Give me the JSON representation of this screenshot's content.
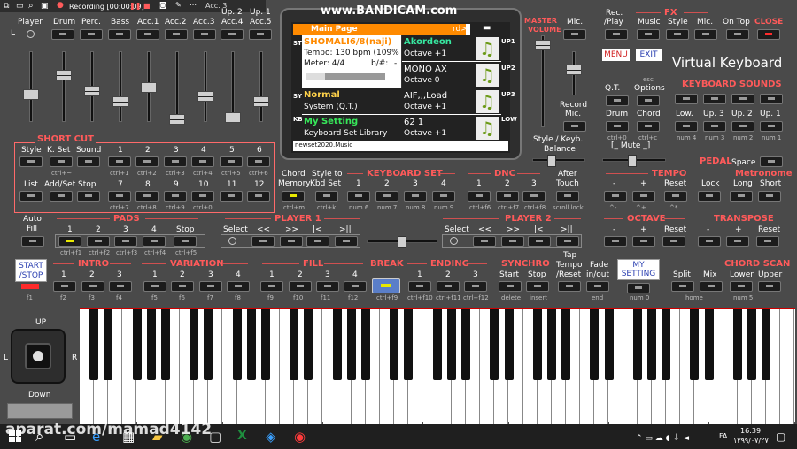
{
  "recorder": {
    "label": "Recording [00:00:09]"
  },
  "watermark": {
    "text": "www.BANDICAM.com",
    "bottom": "aparat.com/mamad4142"
  },
  "title": "Virtual Keyboard",
  "menu_label": "MENU",
  "exit_label": "EXIT",
  "top_mixer": {
    "cols": [
      "Player",
      "Drum",
      "Perc.",
      "Bass",
      "Acc.1",
      "Acc.2",
      "Acc.3",
      "Acc.4",
      "Acc.5"
    ],
    "up_labels": [
      "Up. 2",
      "Up. 1"
    ],
    "l_label": "L"
  },
  "master": {
    "label1": "MASTER",
    "label2": "VOLUME"
  },
  "mic_label": "Mic.",
  "fx": {
    "title": "FX",
    "rec_play": "Rec.\n/Play",
    "rec": "Rec.",
    "play": "/Play",
    "music": "Music",
    "style": "Style",
    "mic": "Mic.",
    "on_top": "On Top",
    "close": "CLOSE"
  },
  "record_mic": {
    "l1": "Record",
    "l2": "Mic."
  },
  "main_page": {
    "header": "Main Page",
    "rd": "rd>",
    "style_tab": "STYLE",
    "style_name": "SHOMALI6/8(naji)",
    "tempo": "Tempo: 130 bpm (109%",
    "meter": "Meter: 4/4",
    "bsharp": "b/#:",
    "minus": "-",
    "upper1": "Akordeon",
    "upper1_oct": "Octave +1",
    "upper2": "MONO AX",
    "upper2_oct": "Octave 0",
    "sys_tab": "SYS",
    "system_name": "Normal",
    "system_sub": "System (Q.T.)",
    "upper3": "AIF,,,Load",
    "upper3_oct": "Octave +1",
    "kbd_tab": "KBD",
    "my_setting": "My Setting",
    "kbd_lib": "Keyboard Set Library",
    "lower": "62 1",
    "lower_oct": "Octave +1",
    "right_tabs": [
      "UP1",
      "UP2",
      "UP3",
      "LOW"
    ],
    "footer": "newset2020.Music"
  },
  "style_keyb": {
    "l1": "Style / Keyb.",
    "l2": "Balance"
  },
  "qt": {
    "l": "Q.T.",
    "esc": "esc",
    "options": "Options"
  },
  "keyboard_sounds": {
    "title": "KEYBOARD SOUNDS",
    "cols": [
      "Low.",
      "Up. 3",
      "Up. 2",
      "Up. 1"
    ],
    "hints": [
      "num 4",
      "num 3",
      "num 2",
      "num 1"
    ]
  },
  "drum_chord": {
    "drum": "Drum",
    "chord": "Chord",
    "drum_hint": "ctrl+0",
    "chord_hint": "ctrl+c",
    "mute": "[_ Mute _]"
  },
  "pedal": {
    "label": "PEDAL",
    "space": "Space"
  },
  "short_cut": {
    "title": "SHORT CUT",
    "row1": [
      "Style",
      "K. Set",
      "Sound",
      "1",
      "2",
      "3",
      "4",
      "5",
      "6"
    ],
    "row1_hints": [
      "ctrl+~",
      "",
      "ctrl+1",
      "ctrl+2",
      "ctrl+3",
      "ctrl+4",
      "ctrl+5",
      "ctrl+6"
    ],
    "row2": [
      "List",
      "Add/Set",
      "Stop",
      "7",
      "8",
      "9",
      "10",
      "11",
      "12"
    ],
    "row2_hints": [
      "ctrl+7",
      "ctrl+8",
      "ctrl+9",
      "ctrl+0"
    ]
  },
  "chord_memory": {
    "l1": "Chord",
    "l2": "Memory",
    "hint": "ctrl+m"
  },
  "style_to": {
    "l1": "Style to",
    "l2": "Kbd Set",
    "hint": "ctrl+k"
  },
  "keyboard_set": {
    "title": "KEYBOARD SET",
    "cols": [
      "1",
      "2",
      "3",
      "4"
    ],
    "hints": [
      "num 6",
      "num 7",
      "num 8",
      "num 9"
    ]
  },
  "dnc": {
    "title": "DNC",
    "cols": [
      "1",
      "2",
      "3"
    ],
    "hints": [
      "ctrl+f6",
      "ctrl+f7",
      "ctrl+f8"
    ]
  },
  "after_touch": {
    "l1": "After",
    "l2": "Touch",
    "hint": "scroll lock"
  },
  "tempo": {
    "title": "TEMPO",
    "cols": [
      "-",
      "+",
      "Reset",
      "Lock"
    ],
    "hints": [
      "^-",
      "^+",
      "^*"
    ]
  },
  "metronome": {
    "title": "Metronome",
    "cols": [
      "Long",
      "Short"
    ]
  },
  "auto_fill": {
    "l1": "Auto",
    "l2": "Fill"
  },
  "pads": {
    "title": "PADS",
    "cols": [
      "1",
      "2",
      "3",
      "4",
      "Stop"
    ],
    "hints": [
      "ctrl+f1",
      "ctrl+f2",
      "ctrl+f3",
      "ctrl+f4",
      "ctrl+f5"
    ]
  },
  "player1": {
    "title": "PLAYER 1",
    "cols": [
      "Select",
      "<<",
      ">>",
      "|<",
      ">||"
    ]
  },
  "player2": {
    "title": "PLAYER 2",
    "cols": [
      "Select",
      "<<",
      ">>",
      "|<",
      ">||"
    ]
  },
  "octave": {
    "title": "OCTAVE",
    "cols": [
      "-",
      "+",
      "Reset"
    ]
  },
  "transpose": {
    "title": "TRANSPOSE",
    "cols": [
      "-",
      "+",
      "Reset"
    ]
  },
  "start_stop": {
    "l1": "START",
    "l2": "/STOP",
    "hint": "f1"
  },
  "intro": {
    "title": "INTRO",
    "cols": [
      "1",
      "2",
      "3"
    ],
    "hints": [
      "f2",
      "f3",
      "f4"
    ]
  },
  "variation": {
    "title": "VARIATION",
    "cols": [
      "1",
      "2",
      "3",
      "4"
    ],
    "hints": [
      "f5",
      "f6",
      "f7",
      "f8"
    ]
  },
  "fill": {
    "title": "FILL",
    "cols": [
      "1",
      "2",
      "3",
      "4"
    ],
    "hints": [
      "f9",
      "f10",
      "f11",
      "f12"
    ]
  },
  "break": {
    "title": "BREAK",
    "hint": "ctrl+f9"
  },
  "ending": {
    "title": "ENDING",
    "cols": [
      "1",
      "2",
      "3"
    ],
    "hints": [
      "ctrl+f10",
      "ctrl+f11",
      "ctrl+f12"
    ]
  },
  "synchro": {
    "title": "SYNCHRO",
    "cols": [
      "Start",
      "Stop"
    ],
    "hints": [
      "delete",
      "insert"
    ]
  },
  "tap_tempo": {
    "l1": "Tap",
    "l2": "Tempo",
    "l3": "/Reset",
    "hint": "end"
  },
  "fade": {
    "l1": "Fade",
    "l2": "in/out"
  },
  "my_setting": {
    "l1": "MY",
    "l2": "SETTING",
    "hint": "num 0"
  },
  "chord_scan": {
    "title": "CHORD SCAN",
    "cols": [
      "Split",
      "Mix",
      "Lower",
      "Upper"
    ],
    "hints": [
      "home",
      "num 5"
    ]
  },
  "joystick": {
    "up": "UP",
    "down": "Down",
    "l": "L",
    "r": "R"
  },
  "taskbar": {
    "time": "16:39",
    "date": "۱۳۹۹/۰۷/۲۷",
    "lang": "FA"
  }
}
